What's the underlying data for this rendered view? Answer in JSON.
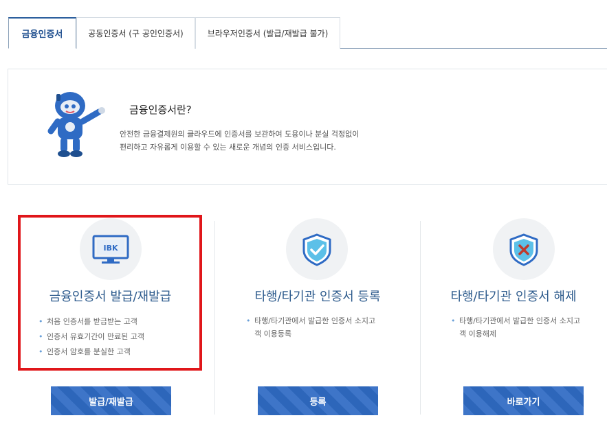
{
  "tabs": [
    {
      "label": "금융인증서",
      "active": true
    },
    {
      "label": "공동인증서 (구 공인인증서)",
      "active": false
    },
    {
      "label": "브라우저인증서 (발급/재발급 불가)",
      "active": false
    }
  ],
  "info": {
    "title": "금융인증서란?",
    "desc_line1": "안전한 금융결제원의 클라우드에 인증서를 보관하여 도용이나 분실 걱정없이",
    "desc_line2": "편리하고 자유롭게 이용할 수 있는 새로운 개념의 인증 서비스입니다."
  },
  "cards": [
    {
      "icon": "ibk-monitor-icon",
      "icon_text": "IBK",
      "title": "금융인증서 발급/재발급",
      "items": [
        "처음 인증서를 받급받는 고객",
        "인증서 유효기간이 만료된 고객",
        "인증서 암호를 분실한 고객"
      ],
      "button": "발급/재발급"
    },
    {
      "icon": "shield-check-icon",
      "title": "타행/타기관 인증서 등록",
      "text_line1": "타행/타기관에서 발급한 인증서 소지고",
      "text_line2": "객 이용등록",
      "button": "등록"
    },
    {
      "icon": "shield-x-icon",
      "title": "타행/타기관 인증서 해제",
      "text_line1": "타행/타기관에서 발급한 인증서 소지고",
      "text_line2": "객 이용해제",
      "button": "바로가기"
    }
  ],
  "colors": {
    "accent": "#2c5a8c",
    "button": "#2f6bc4",
    "highlight": "#e0161a"
  }
}
